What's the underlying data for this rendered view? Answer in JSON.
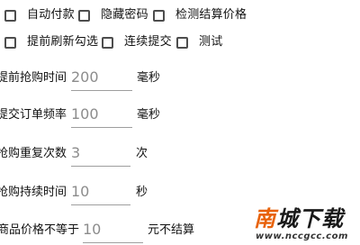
{
  "options_row1": [
    {
      "label": "自动付款",
      "checked": false
    },
    {
      "label": "隐藏密码",
      "checked": false
    },
    {
      "label": "检测结算价格",
      "checked": false
    }
  ],
  "options_row2": [
    {
      "label": "提前刷新勾选",
      "checked": false
    },
    {
      "label": "连续提交",
      "checked": false
    },
    {
      "label": "测试",
      "checked": false
    }
  ],
  "fields": {
    "advance_time": {
      "label": "提前抢购时间",
      "value": "200",
      "unit": "毫秒"
    },
    "submit_frequency": {
      "label": "提交订单频率",
      "value": "100",
      "unit": "毫秒"
    },
    "retry_count": {
      "label": "抢购重复次数",
      "value": "3",
      "unit": "次"
    },
    "duration": {
      "label": "抢购持续时间",
      "value": "10",
      "unit": "秒"
    },
    "price_mismatch": {
      "label": "商品价格不等于",
      "value": "10",
      "unit": "元不结算"
    }
  },
  "watermark": {
    "title_first": "南",
    "title_rest": "城下载",
    "url": "www.nccgcc.com"
  }
}
